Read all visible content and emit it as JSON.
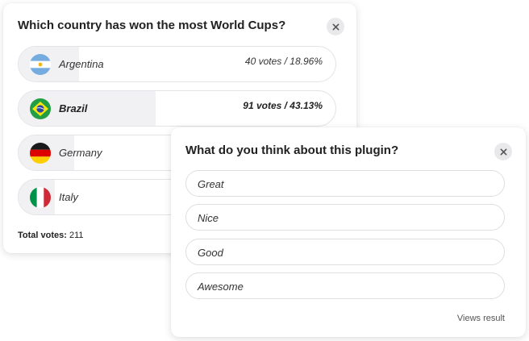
{
  "results_poll": {
    "question": "Which country has won the most World Cups?",
    "options": [
      {
        "label": "Argentina",
        "votes_text": "40 votes / 18.96%",
        "percent": 18.96,
        "flag": "argentina-flag-icon"
      },
      {
        "label": "Brazil",
        "votes_text": "91 votes / 43.13%",
        "percent": 43.13,
        "flag": "brazil-flag-icon"
      },
      {
        "label": "Germany",
        "percent": 17.5,
        "flag": "germany-flag-icon"
      },
      {
        "label": "Italy",
        "percent": 11.4,
        "flag": "italy-flag-icon"
      }
    ],
    "total_label": "Total votes:",
    "total_value": " 211"
  },
  "vote_poll": {
    "question": "What do you think about this plugin?",
    "options": [
      {
        "label": "Great"
      },
      {
        "label": "Nice"
      },
      {
        "label": "Good"
      },
      {
        "label": "Awesome"
      }
    ],
    "views_result_label": "Views result"
  },
  "colors": {
    "result_fill": "#f1f1f3",
    "close_button": "#e9e9ec"
  }
}
